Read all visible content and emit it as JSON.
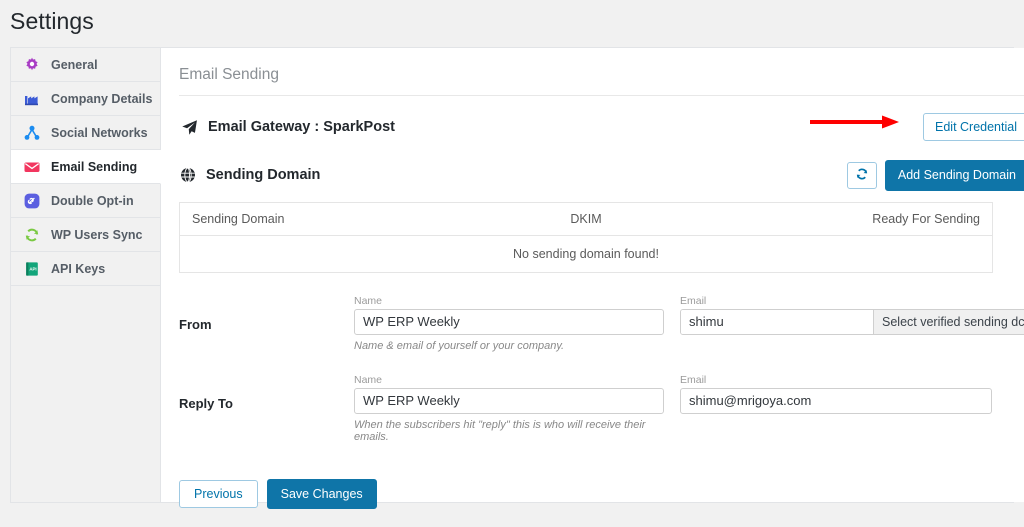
{
  "page": {
    "title": "Settings"
  },
  "sidebar": {
    "items": [
      {
        "label": "General",
        "icon": "gear-icon",
        "color": "#a83cc4",
        "active": false
      },
      {
        "label": "Company Details",
        "icon": "factory-icon",
        "color": "#3b5bd6",
        "active": false
      },
      {
        "label": "Social Networks",
        "icon": "share-nodes-icon",
        "color": "#1b8cf0",
        "active": false
      },
      {
        "label": "Email Sending",
        "icon": "envelope-icon",
        "color": "#f2365f",
        "active": true
      },
      {
        "label": "Double Opt-in",
        "icon": "link-circle-icon",
        "color": "#5b5fe0",
        "active": false
      },
      {
        "label": "WP Users Sync",
        "icon": "sync-icon",
        "color": "#7ac943",
        "active": false
      },
      {
        "label": "API Keys",
        "icon": "api-book-icon",
        "color": "#12a57a",
        "active": false
      }
    ]
  },
  "main": {
    "section_title": "Email Sending",
    "gateway": {
      "icon": "paper-plane-icon",
      "title": "Email Gateway : SparkPost",
      "edit_button": "Edit Credential"
    },
    "sending_domain": {
      "icon": "globe-icon",
      "title": "Sending Domain",
      "refresh_icon": "refresh-icon",
      "add_button": "Add Sending Domain",
      "table": {
        "columns": [
          "Sending Domain",
          "DKIM",
          "Ready For Sending"
        ],
        "empty_message": "No sending domain found!"
      }
    },
    "form": {
      "from": {
        "label": "From",
        "name_label": "Name",
        "name_value": "WP ERP Weekly",
        "email_label": "Email",
        "email_value": "shimu",
        "domain_select_value": "Select verified sending dc",
        "help": "Name & email of yourself or your company."
      },
      "reply_to": {
        "label": "Reply To",
        "name_label": "Name",
        "name_value": "WP ERP Weekly",
        "email_label": "Email",
        "email_value": "shimu@mrigoya.com",
        "help": "When the subscribers hit \"reply\" this is who will receive their emails."
      }
    },
    "footer": {
      "previous": "Previous",
      "save": "Save Changes"
    }
  },
  "annotation": {
    "arrow_color": "#fe0000",
    "points_to": "Edit Credential"
  },
  "colors": {
    "primary_blue": "#0f75a8",
    "link_blue": "#0073aa",
    "page_bg": "#f1f1f1",
    "panel_bg": "#ffffff"
  }
}
